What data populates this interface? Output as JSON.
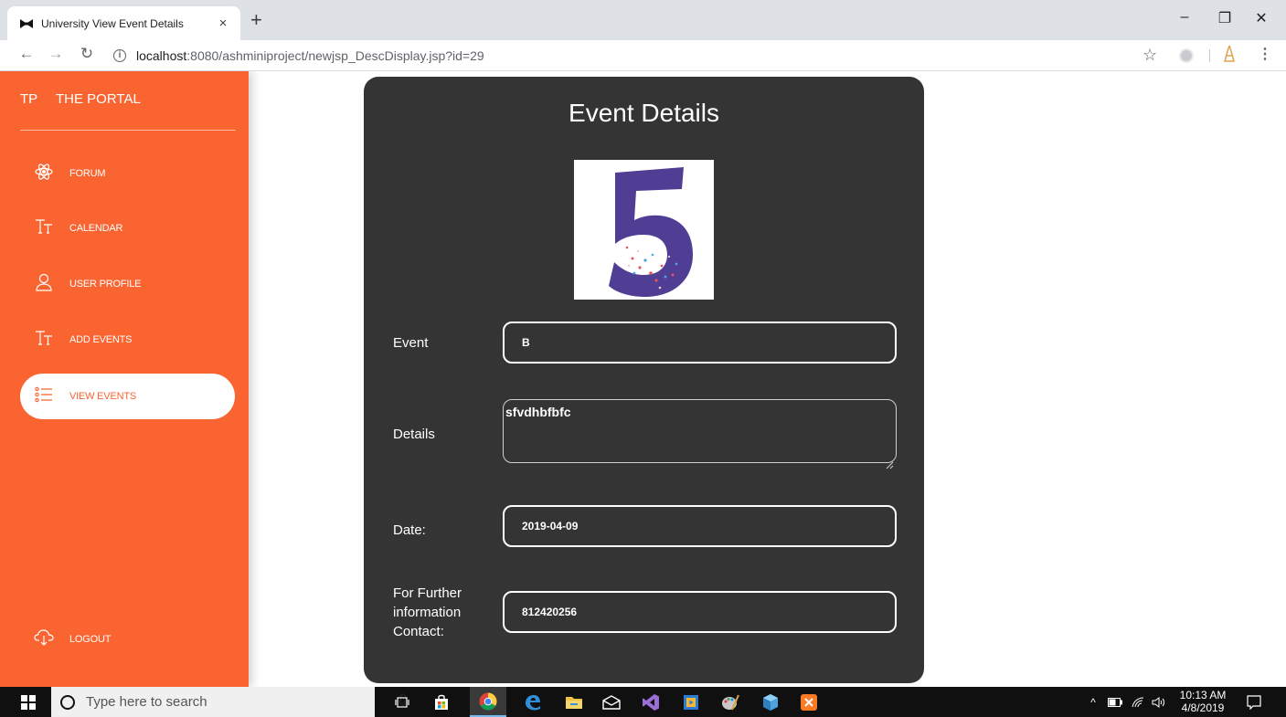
{
  "browser": {
    "tab_title": "University View Event Details",
    "tab_close": "×",
    "new_tab": "+",
    "url_host": "localhost",
    "url_path": ":8080/ashminiproject/newjsp_DescDisplay.jsp?id=29",
    "window_controls": [
      "–",
      "❐",
      "✕"
    ]
  },
  "sidebar": {
    "brand_abbr": "TP",
    "brand_name": "THE PORTAL",
    "items": [
      {
        "label": "FORUM",
        "icon": "atom-icon"
      },
      {
        "label": "CALENDAR",
        "icon": "text-size-icon"
      },
      {
        "label": "USER PROFILE",
        "icon": "user-icon"
      },
      {
        "label": "ADD EVENTS",
        "icon": "text-size-icon"
      },
      {
        "label": "VIEW EVENTS",
        "icon": "list-icon",
        "active": true
      }
    ],
    "logout_label": "LOGOUT"
  },
  "event": {
    "title": "Event Details",
    "event_label": "Event",
    "event_value": "B",
    "details_label": "Details",
    "details_value": "sfvdhbfbfc",
    "date_label": "Date:",
    "date_value": "2019-04-09",
    "contact_label_lines": [
      "For Further",
      "information",
      "Contact:"
    ],
    "contact_value": "812420256"
  },
  "taskbar": {
    "search_placeholder": "Type here to search",
    "time": "10:13 AM",
    "date": "4/8/2019"
  },
  "colors": {
    "sidebar_bg": "#fa6431",
    "card_bg": "#343434",
    "image_purple": "#4f3e93"
  }
}
